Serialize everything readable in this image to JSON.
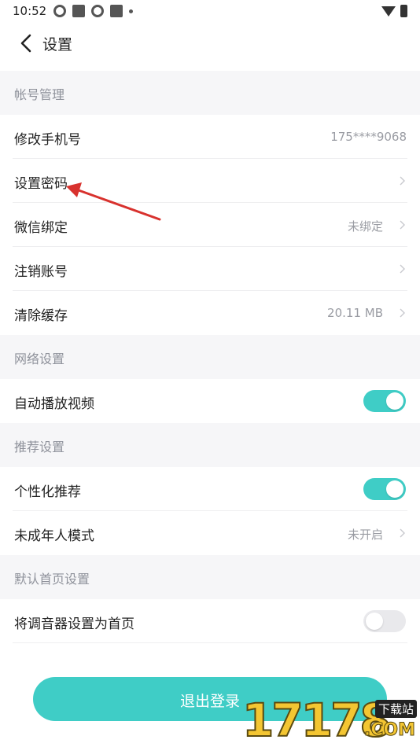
{
  "status_bar": {
    "time": "10:52",
    "icons": [
      "pinwheel-icon",
      "square-icon",
      "pinwheel-icon",
      "square-icon",
      "dot-icon"
    ],
    "right_icons": [
      "wifi-icon",
      "battery-icon"
    ]
  },
  "nav": {
    "title": "设置",
    "back_icon": "chevron-left-icon"
  },
  "sections": {
    "account": {
      "header": "帐号管理"
    },
    "network": {
      "header": "网络设置"
    },
    "recommend": {
      "header": "推荐设置"
    },
    "homepage": {
      "header": "默认首页设置"
    }
  },
  "rows": {
    "phone": {
      "label": "修改手机号",
      "value": "175****9068"
    },
    "password": {
      "label": "设置密码"
    },
    "wechat": {
      "label": "微信绑定",
      "value": "未绑定"
    },
    "cancel_account": {
      "label": "注销账号"
    },
    "cache": {
      "label": "清除缓存",
      "value": "20.11 MB"
    },
    "autoplay": {
      "label": "自动播放视频",
      "toggle": true
    },
    "personalized": {
      "label": "个性化推荐",
      "toggle": true
    },
    "minor_mode": {
      "label": "未成年人模式",
      "value": "未开启"
    },
    "tuner_home": {
      "label": "将调音器设置为首页",
      "toggle": false
    }
  },
  "logout": {
    "label": "退出登录"
  },
  "watermark": {
    "number": "17178",
    "tag": "下载站",
    "suffix": ".COM"
  },
  "colors": {
    "accent": "#3fcdc6",
    "section_bg": "#f6f6f8",
    "annotation_arrow": "#d8322e"
  }
}
